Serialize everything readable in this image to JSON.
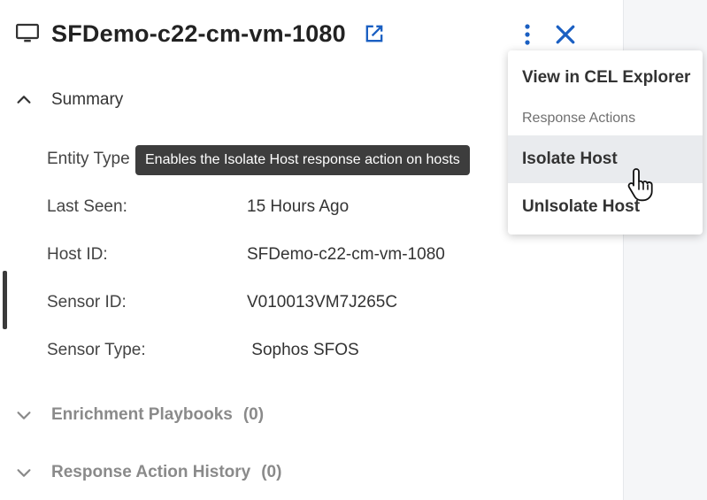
{
  "header": {
    "title": "SFDemo-c22-cm-vm-1080",
    "icon": "monitor-icon",
    "link_icon": "open-in-new-icon"
  },
  "summary": {
    "label": "Summary",
    "rows": [
      {
        "key": "Entity Type",
        "value": ""
      },
      {
        "key": "Last Seen:",
        "value": "15 Hours Ago"
      },
      {
        "key": "Host ID:",
        "value": "SFDemo-c22-cm-vm-1080"
      },
      {
        "key": "Sensor ID:",
        "value": "V010013VM7J265C"
      },
      {
        "key": "Sensor Type:",
        "value": " Sophos SFOS"
      }
    ]
  },
  "sections": {
    "enrichment": {
      "label": "Enrichment Playbooks",
      "count": "(0)"
    },
    "history": {
      "label": "Response Action History",
      "count": "(0)"
    }
  },
  "tooltip": "Enables the Isolate Host response action on hosts",
  "menu": {
    "view": "View in CEL Explorer",
    "section": "Response Actions",
    "isolate": "Isolate Host",
    "unisolate": "UnIsolate Host"
  },
  "colors": {
    "accent": "#1a5fc2",
    "tooltip_bg": "#3d3d3d",
    "menu_hover": "#e9ebee"
  }
}
